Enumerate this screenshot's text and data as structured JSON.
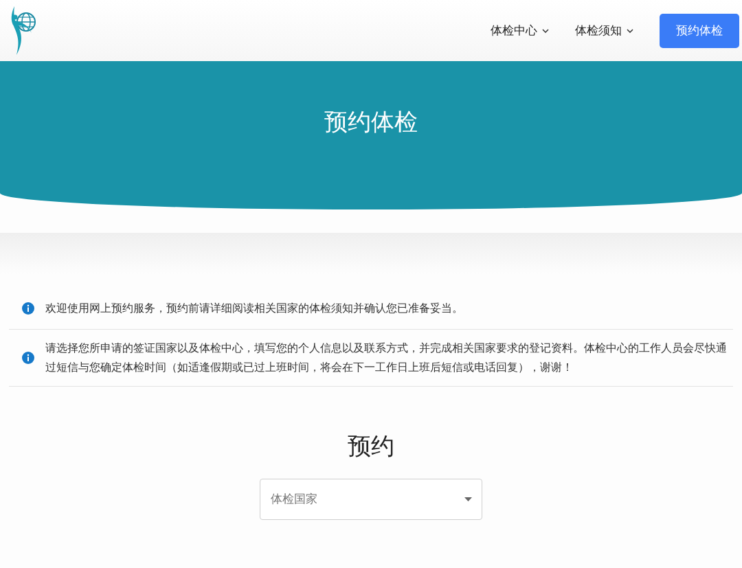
{
  "nav": {
    "items": [
      {
        "label": "体检中心"
      },
      {
        "label": "体检须知"
      }
    ],
    "cta": "预约体检"
  },
  "hero": {
    "title": "预约体检"
  },
  "notices": [
    {
      "text": "欢迎使用网上预约服务，预约前请详细阅读相关国家的体检须知并确认您已准备妥当。"
    },
    {
      "text": "请选择您所申请的签证国家以及体检中心，填写您的个人信息以及联系方式，并完成相关国家要求的登记资料。体检中心的工作人员会尽快通过短信与您确定体检时间（如适逢假期或已过上班时间，将会在下一工作日上班后短信或电话回复），谢谢！"
    }
  ],
  "booking": {
    "title": "预约",
    "country_select": {
      "placeholder": "体检国家"
    }
  }
}
